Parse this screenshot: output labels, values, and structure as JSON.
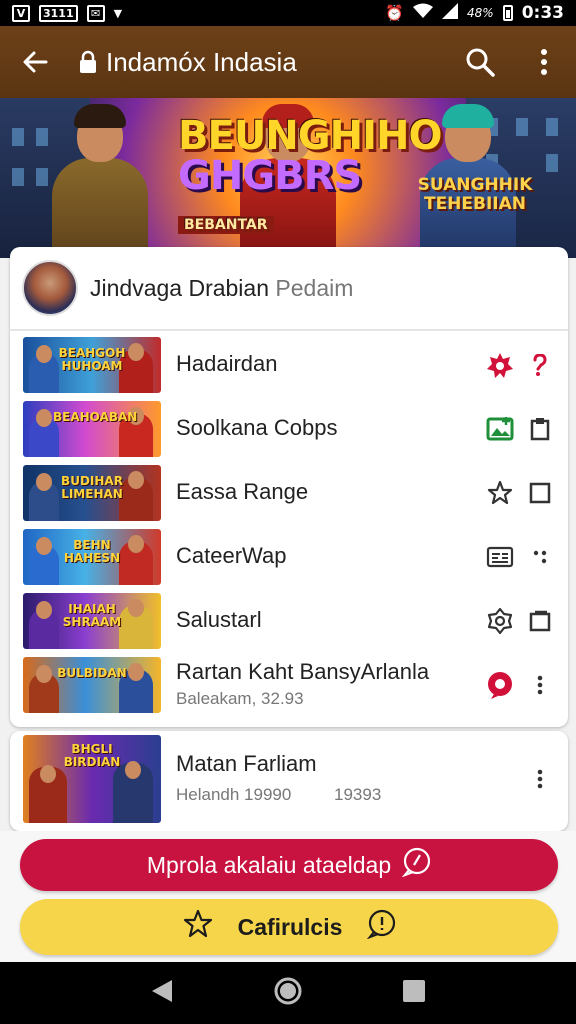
{
  "status_bar": {
    "left_items": [
      "V",
      "3111",
      ""
    ],
    "battery_text": "48%",
    "time": "0:33"
  },
  "app_bar": {
    "title": "Indamóx Indasia",
    "icons": [
      "back-arrow-icon",
      "lock-icon",
      "search-icon",
      "more-vert-icon"
    ]
  },
  "banner": {
    "title_line1": "BEUNGHIHO",
    "title_line2": "GHGBRS",
    "title_line3": "BEBANTAR",
    "right_text": "SUANGHHIK TEHEBIIAN"
  },
  "profile": {
    "name": "Jindvaga Drabian",
    "subtitle": "Pedaim"
  },
  "list": [
    {
      "title": "Hadairdan",
      "subtitle": "",
      "icon1": "flower-badge-icon",
      "icon1_color": "#d1113a",
      "icon2": "question-mark-icon",
      "icon2_color": "#d1113a",
      "thumb_text": "BEAHGOH HUHOAM"
    },
    {
      "title": "Soolkana Cobps",
      "subtitle": "",
      "icon1": "photo-add-icon",
      "icon1_color": "#1f8f3a",
      "icon2": "clipboard-icon",
      "icon2_color": "#333333",
      "thumb_text": "BEAHOABAN"
    },
    {
      "title": "Eassa Range",
      "subtitle": "",
      "icon1": "star-outline-icon",
      "icon1_color": "#333333",
      "icon2": "square-outline-icon",
      "icon2_color": "#333333",
      "thumb_text": "BUDIHAR LIMEHAN"
    },
    {
      "title": "CateerWap",
      "subtitle": "",
      "icon1": "id-card-icon",
      "icon1_color": "#333333",
      "icon2": "dots-icon",
      "icon2_color": "#333333",
      "thumb_text": "BEHN HAHESN"
    },
    {
      "title": "Salustarl",
      "subtitle": "",
      "icon1": "gear-outline-icon",
      "icon1_color": "#333333",
      "icon2": "copy-icon",
      "icon2_color": "#333333",
      "thumb_text": "IHAIAH SHRAAM"
    },
    {
      "title": "Rartan Kaht BansyArlanla",
      "subtitle": "Baleakam, 32.93",
      "icon1": "location-pin-icon",
      "icon1_color": "#d1113a",
      "icon2": "more-vert-icon",
      "icon2_color": "#333333",
      "thumb_text": "BULBIDAN"
    }
  ],
  "list2": {
    "title": "Matan Farliam",
    "subtitle_left": "Helandh 19990",
    "subtitle_right": "19393",
    "icon": "more-vert-icon",
    "thumb_text": "BHGLI BIRDIAN"
  },
  "buttons": {
    "primary": "Mprola akalaiu ataeldap",
    "primary_icon": "chat-bubble-icon",
    "secondary": "Cafirulcis",
    "secondary_icon_left": "star-outline-icon",
    "secondary_icon_right": "chat-bubble-icon"
  },
  "nav": {
    "icons": [
      "nav-back-icon",
      "nav-home-icon",
      "nav-recents-icon"
    ]
  },
  "colors": {
    "appbar": "#5f3713",
    "primary_button": "#c8123f",
    "secondary_button": "#f6d54a"
  }
}
